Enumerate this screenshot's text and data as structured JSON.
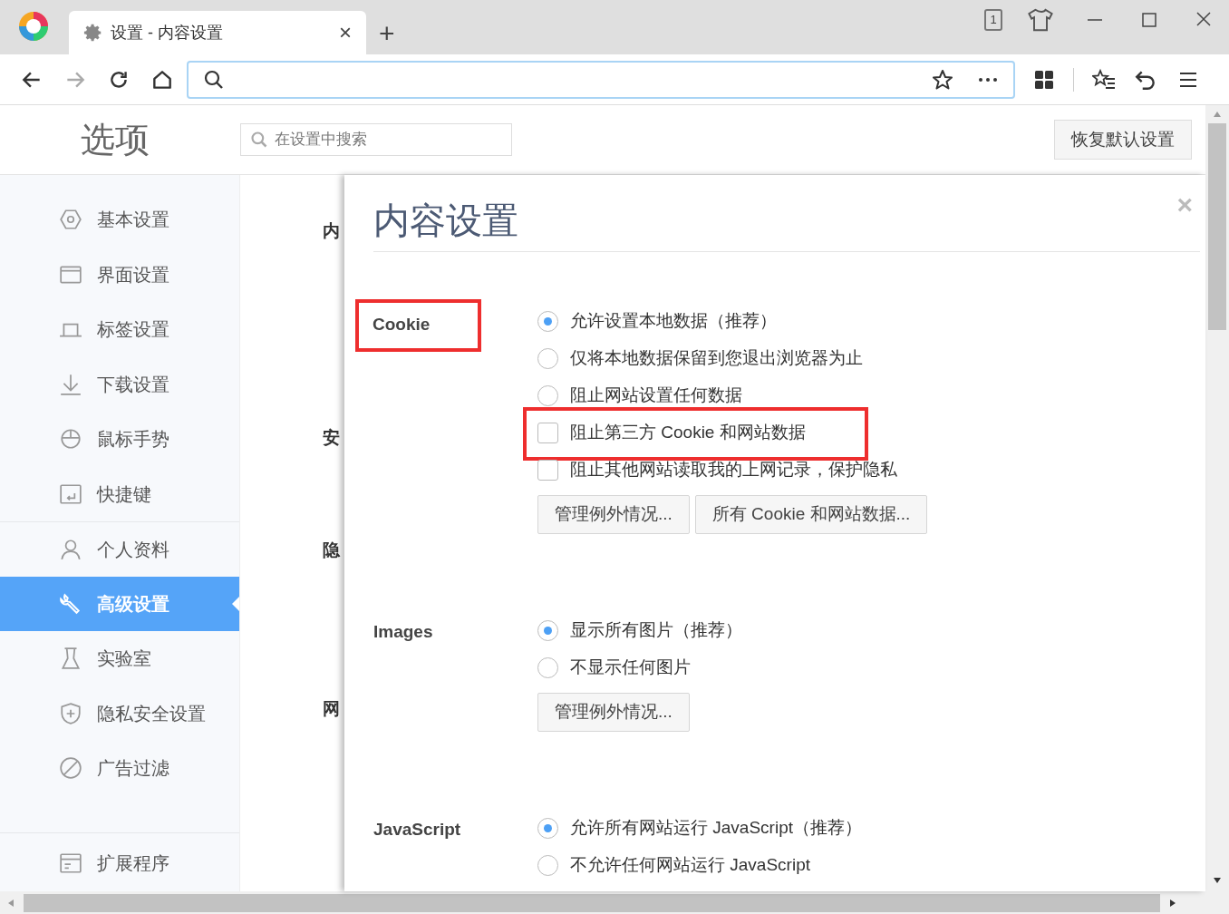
{
  "browser": {
    "tab": {
      "title": "设置 - 内容设置",
      "close": "×"
    },
    "new_tab": "+",
    "tab_count": "1"
  },
  "options_page": {
    "title": "选项",
    "search": {
      "placeholder": "在设置中搜索"
    },
    "reset_button": "恢复默认设置",
    "sidebar": {
      "items": [
        {
          "label": "基本设置",
          "selected": false
        },
        {
          "label": "界面设置",
          "selected": false
        },
        {
          "label": "标签设置",
          "selected": false
        },
        {
          "label": "下载设置",
          "selected": false
        },
        {
          "label": "鼠标手势",
          "selected": false
        },
        {
          "label": "快捷键",
          "selected": false
        },
        {
          "label": "个人资料",
          "selected": false
        },
        {
          "label": "高级设置",
          "selected": true
        },
        {
          "label": "实验室",
          "selected": false
        },
        {
          "label": "隐私安全设置",
          "selected": false
        },
        {
          "label": "广告过滤",
          "selected": false
        }
      ],
      "footer_items": [
        {
          "label": "扩展程序",
          "selected": false
        }
      ]
    },
    "background_labels": [
      "内",
      "安",
      "隐",
      "网"
    ],
    "dialog": {
      "title": "内容设置",
      "close": "×",
      "sections": [
        {
          "label": "Cookie",
          "highlighted": true,
          "options": [
            {
              "kind": "radio",
              "label": "允许设置本地数据（推荐）",
              "selected": true,
              "highlighted": false
            },
            {
              "kind": "radio",
              "label": "仅将本地数据保留到您退出浏览器为止",
              "selected": false,
              "highlighted": false
            },
            {
              "kind": "radio",
              "label": "阻止网站设置任何数据",
              "selected": false,
              "highlighted": false
            },
            {
              "kind": "checkbox",
              "label": "阻止第三方 Cookie 和网站数据",
              "checked": false,
              "highlighted": true
            },
            {
              "kind": "checkbox",
              "label": "阻止其他网站读取我的上网记录，保护隐私",
              "checked": false,
              "highlighted": false
            }
          ],
          "buttons": [
            "管理例外情况...",
            "所有 Cookie 和网站数据..."
          ]
        },
        {
          "label": "Images",
          "highlighted": false,
          "options": [
            {
              "kind": "radio",
              "label": "显示所有图片（推荐）",
              "selected": true,
              "highlighted": false
            },
            {
              "kind": "radio",
              "label": "不显示任何图片",
              "selected": false,
              "highlighted": false
            }
          ],
          "buttons": [
            "管理例外情况..."
          ]
        },
        {
          "label": "JavaScript",
          "highlighted": false,
          "options": [
            {
              "kind": "radio",
              "label": "允许所有网站运行 JavaScript（推荐）",
              "selected": true,
              "highlighted": false
            },
            {
              "kind": "radio",
              "label": "不允许任何网站运行 JavaScript",
              "selected": false,
              "highlighted": false
            }
          ]
        }
      ]
    }
  }
}
